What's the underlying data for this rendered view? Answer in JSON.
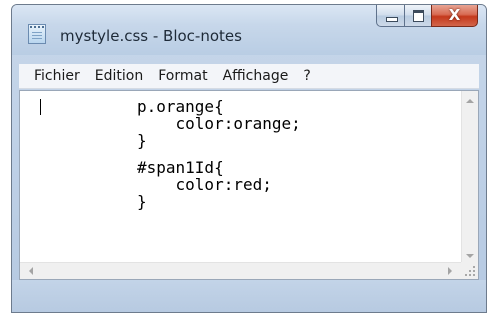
{
  "window": {
    "title": "mystyle.css - Bloc-notes",
    "caption": {
      "minimize_icon": "minimize-icon",
      "maximize_icon": "maximize-icon",
      "close_glyph": "X"
    }
  },
  "menu": {
    "items": [
      "Fichier",
      "Edition",
      "Format",
      "Affichage",
      "?"
    ]
  },
  "editor": {
    "lines": [
      "p.orange{",
      "    color:orange;",
      "}",
      "",
      "#span1Id{",
      "    color:red;",
      "}"
    ]
  },
  "colors": {
    "frame": "#b9cde4",
    "close_button": "#c4381b",
    "text": "#000000"
  }
}
